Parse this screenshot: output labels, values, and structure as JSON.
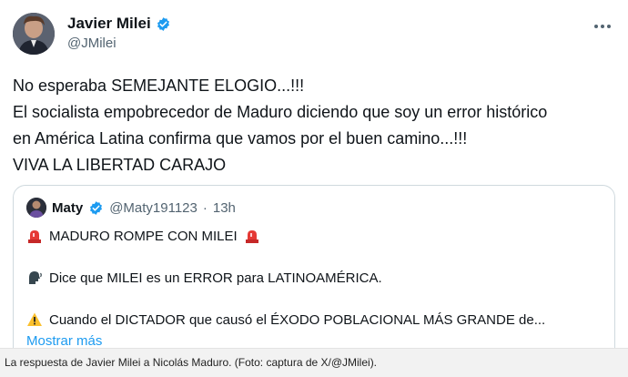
{
  "author": {
    "name": "Javier Milei",
    "handle": "@JMilei"
  },
  "menu_icon": "more-icon",
  "tweet_lines": [
    "No esperaba SEMEJANTE ELOGIO...!!!",
    "El socialista empobrecedor de Maduro diciendo que soy un error histórico",
    "en América Latina confirma que vamos por el buen camino...!!!",
    "VIVA LA LIBERTAD CARAJO"
  ],
  "quote": {
    "name": "Maty",
    "handle": "@Maty191123",
    "separator": "·",
    "time": "13h",
    "line1": "MADURO ROMPE CON MILEI",
    "line2": "Dice que MILEI es un ERROR para LATINOAMÉRICA.",
    "line3": "Cuando el DICTADOR que causó el ÉXODO POBLACIONAL MÁS GRANDE de...",
    "show_more": "Mostrar más"
  },
  "caption": "La respuesta de Javier Milei a Nicolás Maduro. (Foto: captura de X/@JMilei).",
  "colors": {
    "verified": "#1d9bf0",
    "link": "#1d9bf0",
    "text": "#0f1419",
    "muted": "#536471"
  }
}
